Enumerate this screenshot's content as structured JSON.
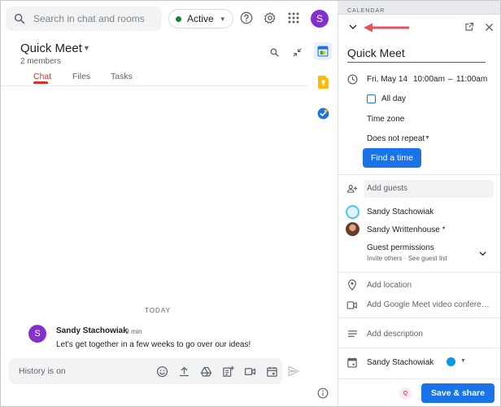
{
  "search": {
    "placeholder": "Search in chat and rooms"
  },
  "status": {
    "label": "Active",
    "color": "#188038"
  },
  "user": {
    "initial": "S",
    "avatar_color": "#8430ce"
  },
  "room": {
    "title": "Quick Meet",
    "members": "2 members",
    "tabs": [
      {
        "label": "Chat",
        "active": true
      },
      {
        "label": "Files",
        "active": false
      },
      {
        "label": "Tasks",
        "active": false
      }
    ]
  },
  "messages": {
    "divider": "TODAY",
    "items": [
      {
        "initial": "S",
        "author": "Sandy Stachowiak",
        "time": "9 min",
        "text": "Let's get together in a few weeks to go over our ideas!"
      }
    ]
  },
  "composer": {
    "placeholder": "History is on"
  },
  "panel": {
    "header_label": "CALENDAR",
    "event_title": "Quick Meet",
    "date": "Fri, May 14",
    "start": "10:00am",
    "dash": "–",
    "end": "11:00am",
    "all_day": "All day",
    "time_zone": "Time zone",
    "repeat": "Does not repeat",
    "find_time": "Find a time",
    "add_guests": "Add guests",
    "guests": [
      {
        "name": "Sandy Stachowiak"
      },
      {
        "name": "Sandy Writtenhouse *"
      }
    ],
    "guest_permissions": "Guest permissions",
    "permissions_detail": "Invite others · See guest list",
    "add_location": "Add location",
    "add_meet": "Add Google Meet video conferen...",
    "add_description": "Add description",
    "calendar_owner": "Sandy Stachowiak",
    "calendar_color": "#039be5",
    "save_share": "Save & share",
    "badge": "Q"
  },
  "colors": {
    "accent": "#1a73e8",
    "active_tab": "#d93025",
    "arrow": "#e8505b"
  }
}
